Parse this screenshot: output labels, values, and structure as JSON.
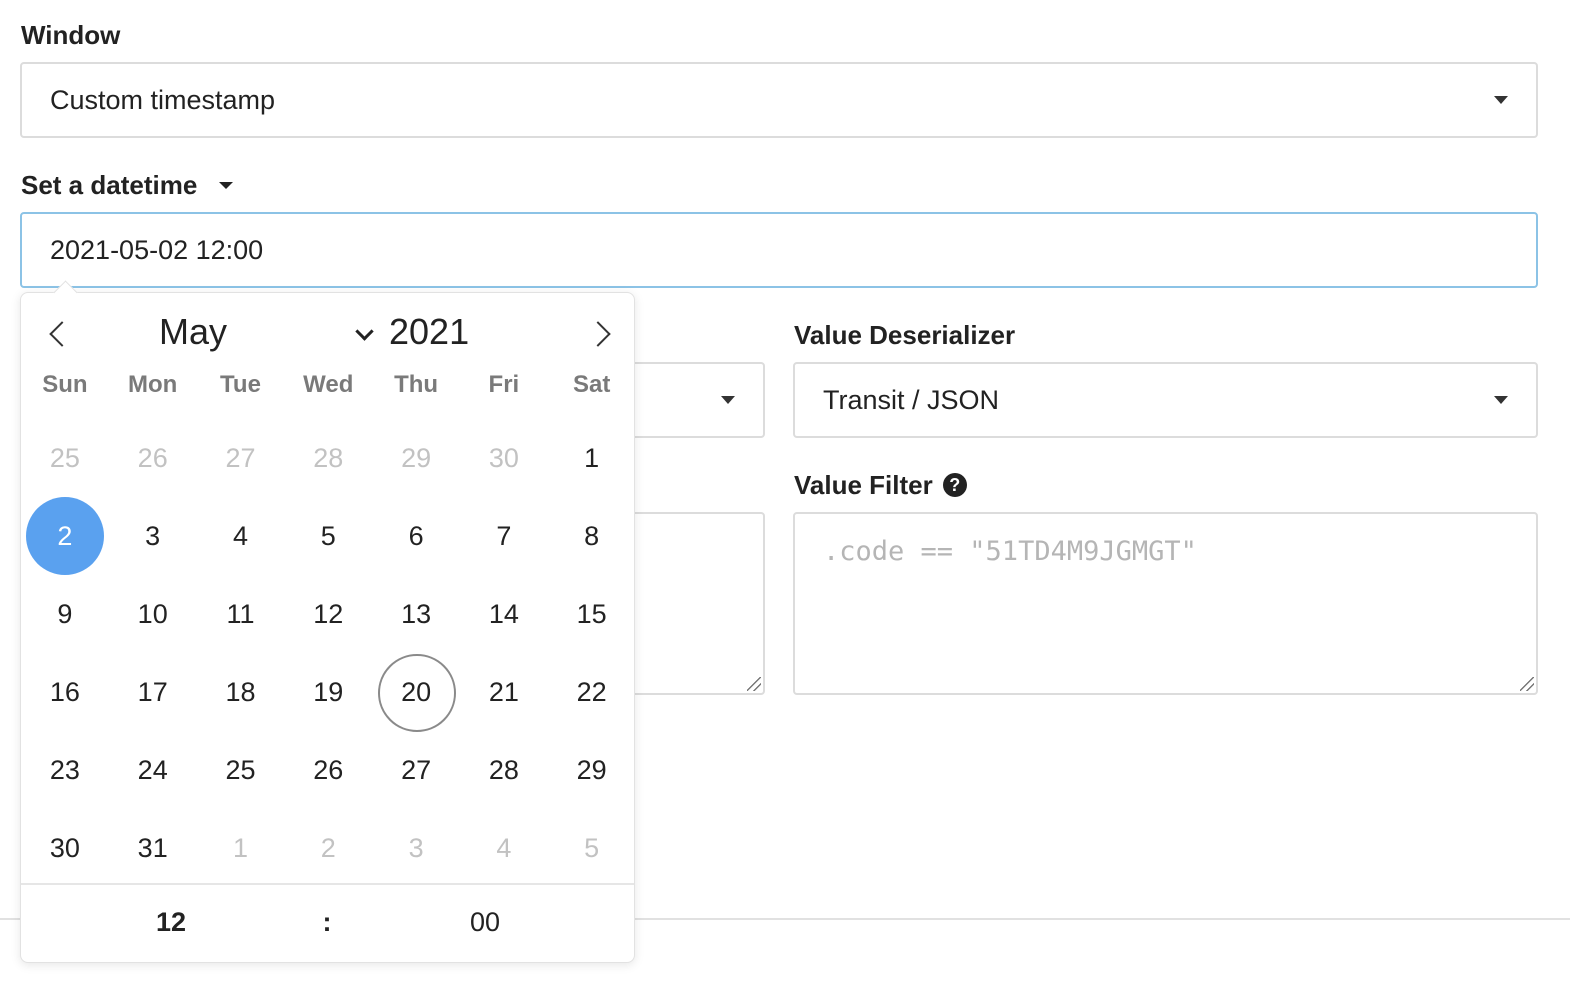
{
  "window": {
    "label": "Window",
    "value": "Custom timestamp"
  },
  "datetime": {
    "label": "Set a datetime",
    "value": "2021-05-02 12:00"
  },
  "value_deserializer": {
    "label": "Value Deserializer",
    "value": "Transit / JSON"
  },
  "value_filter": {
    "label": "Value Filter",
    "placeholder": ".code == \"51TD4M9JGMGT\""
  },
  "calendar": {
    "month": "May",
    "year": "2021",
    "weekdays": [
      "Sun",
      "Mon",
      "Tue",
      "Wed",
      "Thu",
      "Fri",
      "Sat"
    ],
    "weeks": [
      [
        "25",
        "26",
        "27",
        "28",
        "29",
        "30",
        "1"
      ],
      [
        "2",
        "3",
        "4",
        "5",
        "6",
        "7",
        "8"
      ],
      [
        "9",
        "10",
        "11",
        "12",
        "13",
        "14",
        "15"
      ],
      [
        "16",
        "17",
        "18",
        "19",
        "20",
        "21",
        "22"
      ],
      [
        "23",
        "24",
        "25",
        "26",
        "27",
        "28",
        "29"
      ],
      [
        "30",
        "31",
        "1",
        "2",
        "3",
        "4",
        "5"
      ]
    ],
    "selected_day": "2",
    "today_day": "20",
    "time": {
      "hour": "12",
      "separator": ":",
      "minute": "00"
    }
  },
  "colors": {
    "accent": "#5aa1ef",
    "focus_border": "#8cc3e6"
  }
}
